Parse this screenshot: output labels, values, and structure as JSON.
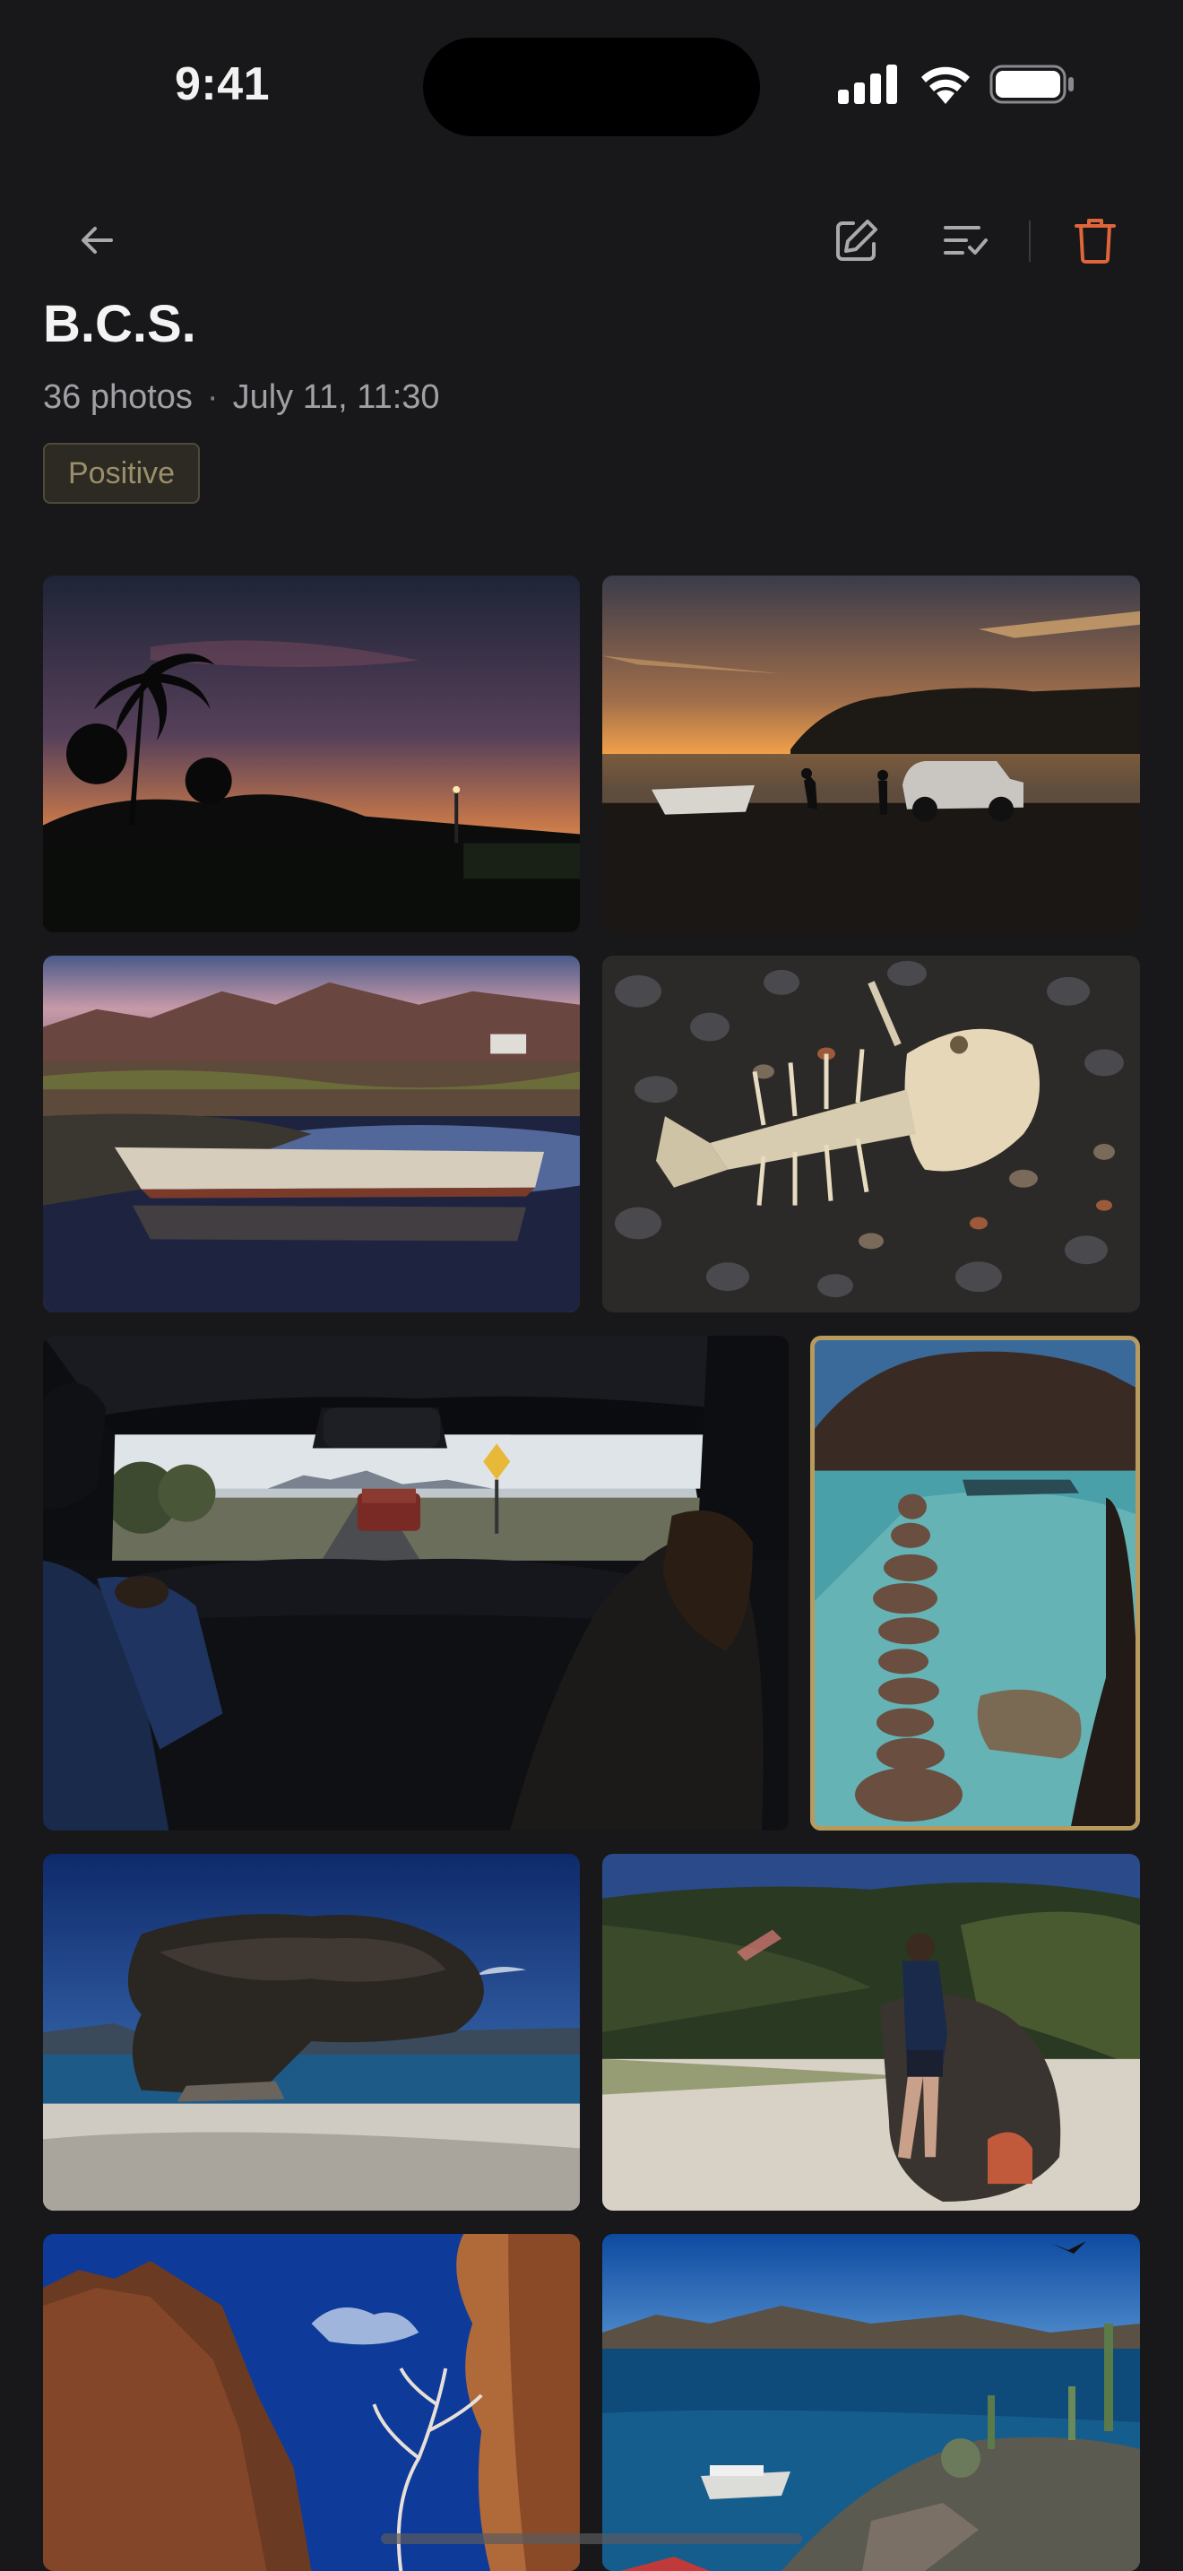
{
  "status_bar": {
    "time": "9:41"
  },
  "toolbar": {
    "back_icon": "arrow-left-icon",
    "edit_icon": "pencil-square-icon",
    "sort_icon": "list-check-icon",
    "delete_icon": "trash-icon",
    "delete_color": "#e0653a"
  },
  "album": {
    "title": "B.C.S.",
    "photo_count": "36 photos",
    "separator": "·",
    "date": "July 11, 11:30",
    "tag": "Positive"
  },
  "colors": {
    "background": "#18181a",
    "selection_border": "#b79a5e",
    "tag_text": "#9b8e6a"
  },
  "photos": [
    {
      "subject": "palm-trees-sunset",
      "selected": false
    },
    {
      "subject": "boat-truck-beach-sunset",
      "selected": false
    },
    {
      "subject": "rowboat-lagoon-mountains",
      "selected": false
    },
    {
      "subject": "fish-skeleton-pebbles",
      "selected": false
    },
    {
      "subject": "car-interior-road",
      "selected": false
    },
    {
      "subject": "stacked-stones-beach",
      "selected": true
    },
    {
      "subject": "volcanic-rock-beach",
      "selected": false
    },
    {
      "subject": "woman-leaning-rock",
      "selected": false
    },
    {
      "subject": "cliff-tree-sky",
      "selected": false
    },
    {
      "subject": "bay-boat-cactus",
      "selected": false
    }
  ]
}
